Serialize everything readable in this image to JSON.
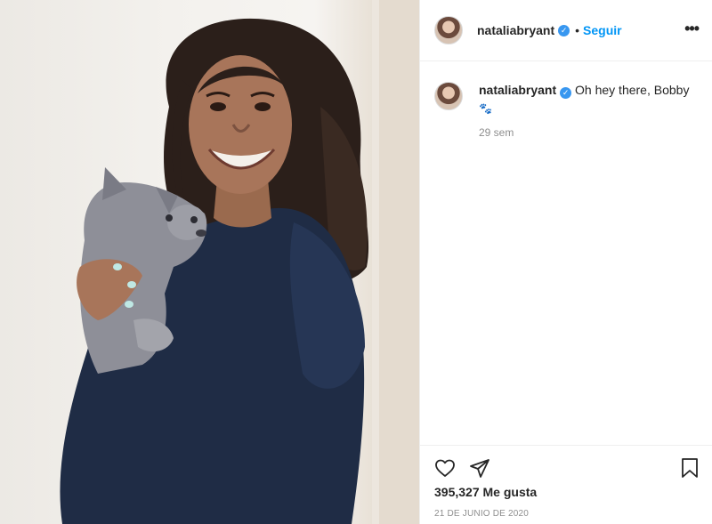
{
  "post": {
    "photo_alt": "Smiling young woman in a navy hoodie holding a grey French bulldog puppy"
  },
  "header": {
    "username": "nataliabryant",
    "verified": true,
    "separator": "•",
    "follow_label": "Seguir",
    "more_label": "•••"
  },
  "caption": {
    "username": "nataliabryant",
    "text": "Oh hey there, Bobby",
    "emoji": "🐾",
    "time_ago": "29 sem"
  },
  "actions": {
    "likes": "395,327 Me gusta",
    "date": "21 DE JUNIO DE 2020"
  },
  "colors": {
    "link_blue": "#0095f6",
    "verified_blue": "#3897f0",
    "text": "#262626",
    "muted": "#8e8e8e"
  },
  "icons": [
    "heart-icon",
    "share-icon",
    "bookmark-icon",
    "verified-icon",
    "more-icon"
  ]
}
